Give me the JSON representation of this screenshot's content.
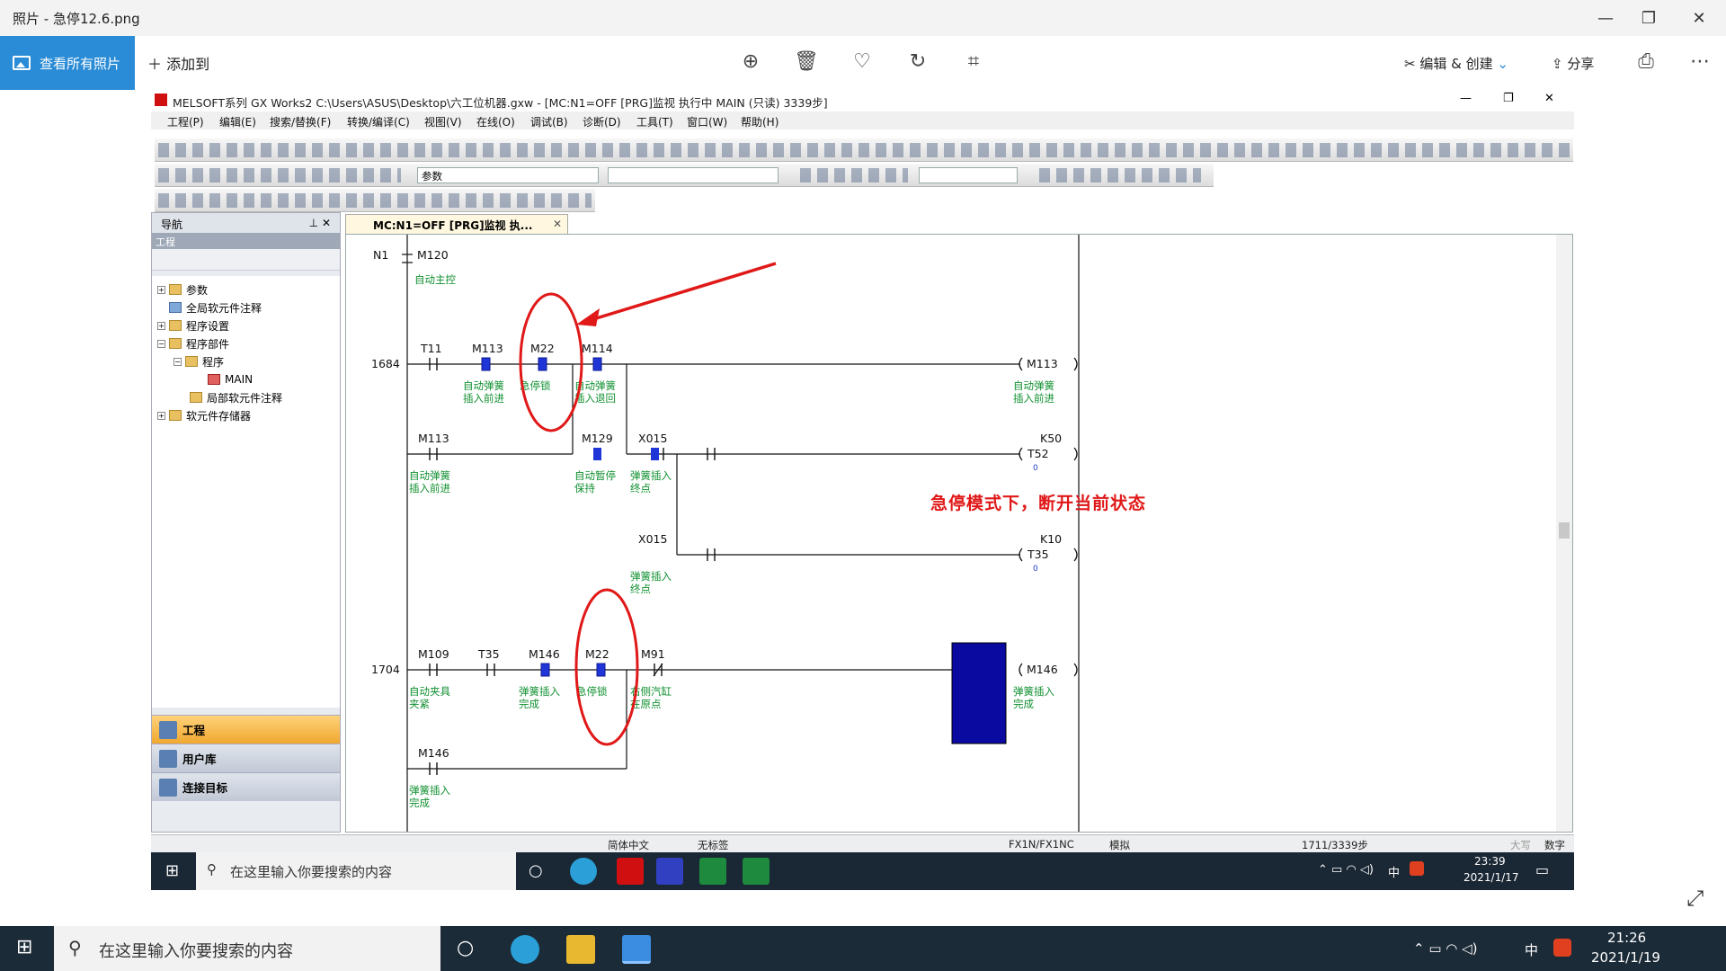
{
  "photos": {
    "title": "照片 - 急停12.6.png",
    "view_all": "查看所有照片",
    "add_to": "添加到",
    "edit_create": "编辑 & 创建",
    "share": "分享"
  },
  "gxworks": {
    "title": "MELSOFT系列 GX Works2 C:\\Users\\ASUS\\Desktop\\六工位机器.gxw - [MC:N1=OFF [PRG]监视 执行中 MAIN (只读) 3339步]",
    "menu": [
      "工程(P)",
      "编辑(E)",
      "搜索/替换(F)",
      "转换/编译(C)",
      "视图(V)",
      "在线(O)",
      "调试(B)",
      "诊断(D)",
      "工具(T)",
      "窗口(W)",
      "帮助(H)"
    ],
    "combo_param": "参数",
    "nav_title": "导航",
    "nav_sub": "工程",
    "tree": [
      "参数",
      "全局软元件注释",
      "程序设置",
      "程序部件",
      "程序",
      "MAIN",
      "局部软元件注释",
      "软元件存储器"
    ],
    "nav_buttons": [
      "工程",
      "用户库",
      "连接目标"
    ],
    "tab_label": "MC:N1=OFF [PRG]监视 执..."
  },
  "ladder": {
    "mc": {
      "n": "N1",
      "dev": "M120",
      "comment": "自动主控"
    },
    "step1": "1684",
    "step2": "1704",
    "c": {
      "t11": "T11",
      "m113a": "M113",
      "m22a": "M22",
      "m114": "M114",
      "out_m113": "M113",
      "m113b": "M113",
      "m129": "M129",
      "x015a": "X015",
      "k50": "K50",
      "t52": "T52",
      "x015b": "X015",
      "k10": "K10",
      "t35out": "T35",
      "m109": "M109",
      "t35": "T35",
      "m146a": "M146",
      "m22b": "M22",
      "m91": "M91",
      "out_m146": "M146",
      "m146b": "M146"
    },
    "cm": {
      "m113a_1": "自动弹簧",
      "m113a_2": "插入前进",
      "m22": "急停锁",
      "m114_1": "自动弹簧",
      "m114_2": "插入退回",
      "out_m113_1": "自动弹簧",
      "out_m113_2": "插入前进",
      "m113b_1": "自动弹簧",
      "m113b_2": "插入前进",
      "m129_1": "自动暂停",
      "m129_2": "保持",
      "x015_1": "弹簧插入",
      "x015_2": "终点",
      "x015c_1": "弹簧插入",
      "x015c_2": "终点",
      "m109_1": "自动夹具",
      "m109_2": "夹紧",
      "m146_1": "弹簧插入",
      "m146_2": "完成",
      "m22b": "急停锁",
      "m91_1": "右侧汽缸",
      "m91_2": "在原点",
      "out_m146_1": "弹簧插入",
      "out_m146_2": "完成",
      "m146b_1": "弹簧插入",
      "m146b_2": "完成"
    },
    "zero": "0",
    "annotation": "急停模式下，断开当前状态"
  },
  "status": {
    "lang": "简体中文",
    "label": "无标签",
    "cpu": "FX1N/FX1NC",
    "mode": "模拟",
    "steps": "1711/3339步",
    "caps": "大写",
    "num": "数字"
  },
  "inner_taskbar": {
    "search": "在这里输入你要搜索的内容",
    "ime": "中",
    "time": "23:39",
    "date": "2021/1/17"
  },
  "taskbar": {
    "search": "在这里输入你要搜索的内容",
    "ime": "中",
    "time": "21:26",
    "date": "2021/1/19"
  },
  "colors": {
    "accent": "#2a8bd6",
    "annotation_red": "#e01818",
    "comment_green": "#109030",
    "output_blue": "#0a0aa0"
  }
}
